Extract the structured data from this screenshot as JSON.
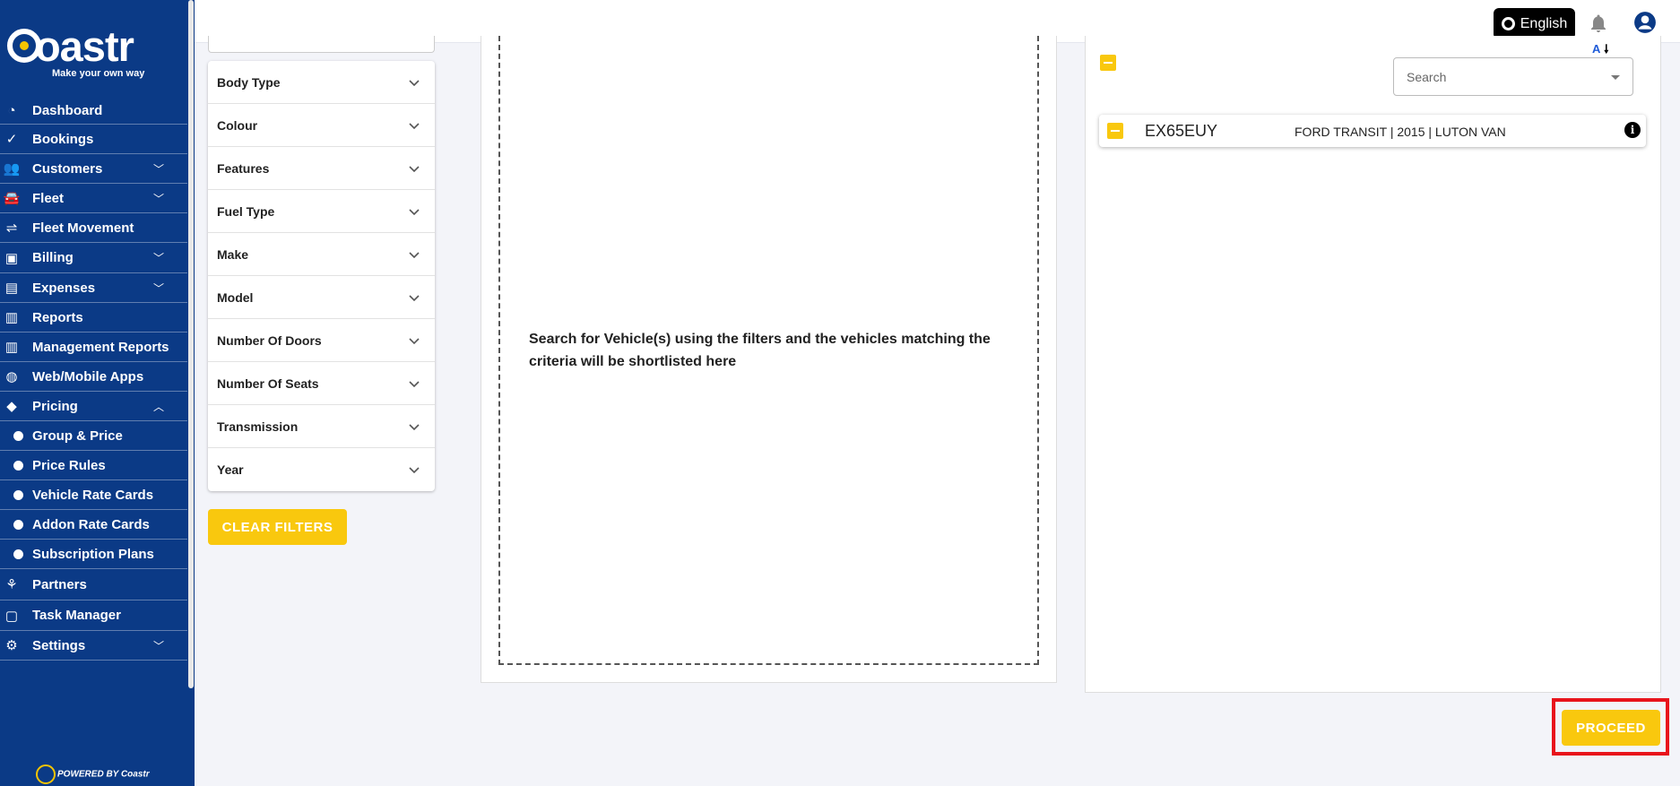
{
  "brand": {
    "name": "Coastr",
    "tagline": "Make your own way",
    "powered_by": "POWERED BY Coastr"
  },
  "sidebar": {
    "items": [
      {
        "label": "Dashboard",
        "icon": "dashboard-icon",
        "chevron": ""
      },
      {
        "label": "Bookings",
        "icon": "check-circle-icon",
        "chevron": ""
      },
      {
        "label": "Customers",
        "icon": "people-icon",
        "chevron": "down"
      },
      {
        "label": "Fleet",
        "icon": "car-icon",
        "chevron": "down"
      },
      {
        "label": "Fleet Movement",
        "icon": "fleet-movement-icon",
        "chevron": ""
      },
      {
        "label": "Billing",
        "icon": "billing-icon",
        "chevron": "down"
      },
      {
        "label": "Expenses",
        "icon": "card-icon",
        "chevron": "down"
      },
      {
        "label": "Reports",
        "icon": "bar-chart-icon",
        "chevron": ""
      },
      {
        "label": "Management Reports",
        "icon": "bar-chart-icon",
        "chevron": ""
      },
      {
        "label": "Web/Mobile Apps",
        "icon": "globe-icon",
        "chevron": ""
      },
      {
        "label": "Pricing",
        "icon": "tag-icon",
        "chevron": "up"
      },
      {
        "label": "Group & Price",
        "sub": true
      },
      {
        "label": "Price Rules",
        "sub": true
      },
      {
        "label": "Vehicle Rate Cards",
        "sub": true
      },
      {
        "label": "Addon Rate Cards",
        "sub": true
      },
      {
        "label": "Subscription Plans",
        "sub": true
      },
      {
        "label": "Partners",
        "icon": "handshake-icon",
        "chevron": ""
      },
      {
        "label": "Task Manager",
        "icon": "calendar-icon",
        "chevron": ""
      },
      {
        "label": "Settings",
        "icon": "gear-icon",
        "chevron": "down"
      }
    ]
  },
  "topbar": {
    "language": "English"
  },
  "filters": {
    "items": [
      "Body Type",
      "Colour",
      "Features",
      "Fuel Type",
      "Make",
      "Model",
      "Number Of Doors",
      "Number Of Seats",
      "Transmission",
      "Year"
    ],
    "clear_label": "CLEAR FILTERS"
  },
  "results": {
    "empty_message": "Search for Vehicle(s) using the filters and the vehicles matching the criteria will be shortlisted here"
  },
  "selected": {
    "sort_label": "A",
    "search_placeholder": "Search",
    "vehicles": [
      {
        "plate": "EX65EUY",
        "description": "FORD TRANSIT | 2015 | LUTON VAN"
      }
    ]
  },
  "actions": {
    "proceed_label": "PROCEED"
  },
  "colors": {
    "sidebar": "#0b3a86",
    "accent": "#f9c80e",
    "highlight": "#e8141c"
  }
}
